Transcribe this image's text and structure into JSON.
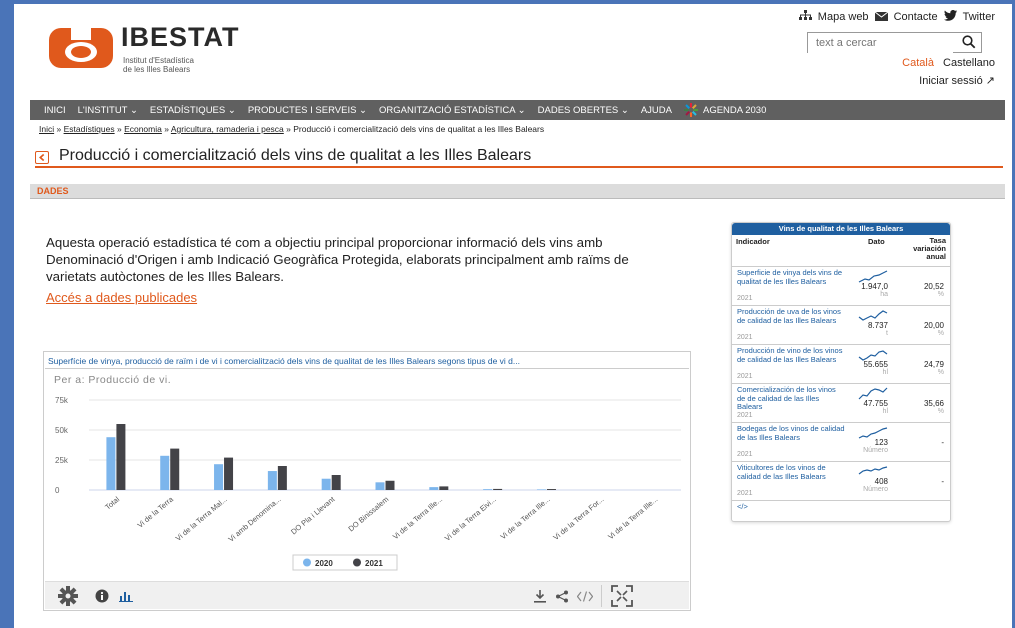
{
  "header": {
    "logo_title": "IBESTAT",
    "logo_sub1": "Institut d'Estadística",
    "logo_sub2": "de les Illes Balears",
    "links": {
      "sitemap": "Mapa web",
      "contact": "Contacte",
      "twitter": "Twitter"
    },
    "search": {
      "placeholder": "text a cercar"
    },
    "languages": {
      "active": "Català",
      "other": "Castellano"
    },
    "login": "Iniciar sessió ↗"
  },
  "nav": {
    "items": [
      "INICI",
      "L'INSTITUT ⌄",
      "ESTADÍSTIQUES ⌄",
      "PRODUCTES I SERVEIS ⌄",
      "ORGANITZACIÓ ESTADÍSTICA ⌄",
      "DADES OBERTES ⌄",
      "AJUDA",
      "AGENDA 2030"
    ]
  },
  "breadcrumb": {
    "items": [
      "Inici",
      "Estadístiques",
      "Economia",
      "Agricultura, ramaderia i pesca"
    ],
    "current": "Producció i comercialització dels vins de qualitat a les Illes Balears"
  },
  "page_title": "Producció i comercialització dels vins de qualitat a les Illes Balears",
  "section_label": "DADES",
  "intro": "Aquesta operació estadística té com a objectiu principal proporcionar informació dels vins amb Denominació d'Origen i amb Indicació Geogràfica Protegida, elaborats principalment amb raïms de varietats autòctones de les Illes Balears.",
  "access_link": "Accés a dades publicades",
  "chart_panel": {
    "title": "Superfície de vinya, producció de raïm i de vi i comercialització dels vins de qualitat de les Illes Balears segons tipus de vi d...",
    "filter_label": "Per a: Producció de vi."
  },
  "chart_data": {
    "type": "bar",
    "categories": [
      "Total",
      "Vi de la Terra",
      "Vi de la Terra Mal...",
      "Vi amb Denomina...",
      "DO Pla i Llevant",
      "DO Binissalem",
      "Vi de la Terra Ille...",
      "Vi de la Terra Eivi...",
      "Vi de la Terra Ille...",
      "Vi de la Terra For...",
      "Vi de la Terra Ille..."
    ],
    "series": [
      {
        "name": "2020",
        "color": "#7cb5ec",
        "values": [
          44000,
          28500,
          21500,
          15800,
          9400,
          6400,
          2400,
          700,
          500,
          0,
          0
        ]
      },
      {
        "name": "2021",
        "color": "#434348",
        "values": [
          55000,
          34500,
          27000,
          20000,
          12500,
          7700,
          3000,
          900,
          800,
          0,
          0
        ]
      }
    ],
    "yticks": [
      "0",
      "25k",
      "50k",
      "75k"
    ],
    "ylim": [
      0,
      75000
    ],
    "legend": "bottom-center"
  },
  "side_panel": {
    "header": "Vins de qualitat de les Illes Balears",
    "col_indicator": "Indicador",
    "col_value": "Dato",
    "col_rate": "Tasa variación anual",
    "rows": [
      {
        "name": "Superficie de vinya dels vins de qualitat de les Illes Balears",
        "year": "2021",
        "value": "1.947,0",
        "unit": "ha",
        "rate": "20,52",
        "rate_unit": "%"
      },
      {
        "name": "Producción de uva de los vinos de calidad de las Illes Balears",
        "year": "2021",
        "value": "8.737",
        "unit": "t",
        "rate": "20,00",
        "rate_unit": "%"
      },
      {
        "name": "Producción de vino de los vinos de calidad de las Illes Balears",
        "year": "2021",
        "value": "55.655",
        "unit": "hl",
        "rate": "24,79",
        "rate_unit": "%"
      },
      {
        "name": "Comercialización de los vinos de de calidad de las Illes Balears",
        "year": "2021",
        "value": "47.755",
        "unit": "hl",
        "rate": "35,66",
        "rate_unit": "%"
      },
      {
        "name": "Bodegas de los vinos de calidad de las Illes Balears",
        "year": "2021",
        "value": "123",
        "unit": "Número",
        "rate": "-",
        "rate_unit": ""
      },
      {
        "name": "Viticultores de los vinos de calidad de las Illes Balears",
        "year": "2021",
        "value": "408",
        "unit": "Número",
        "rate": "-",
        "rate_unit": ""
      }
    ],
    "embed_label": "</>"
  },
  "colors": {
    "accent": "#e0591c",
    "nav": "#606060",
    "link_blue": "#1f5fa0"
  }
}
